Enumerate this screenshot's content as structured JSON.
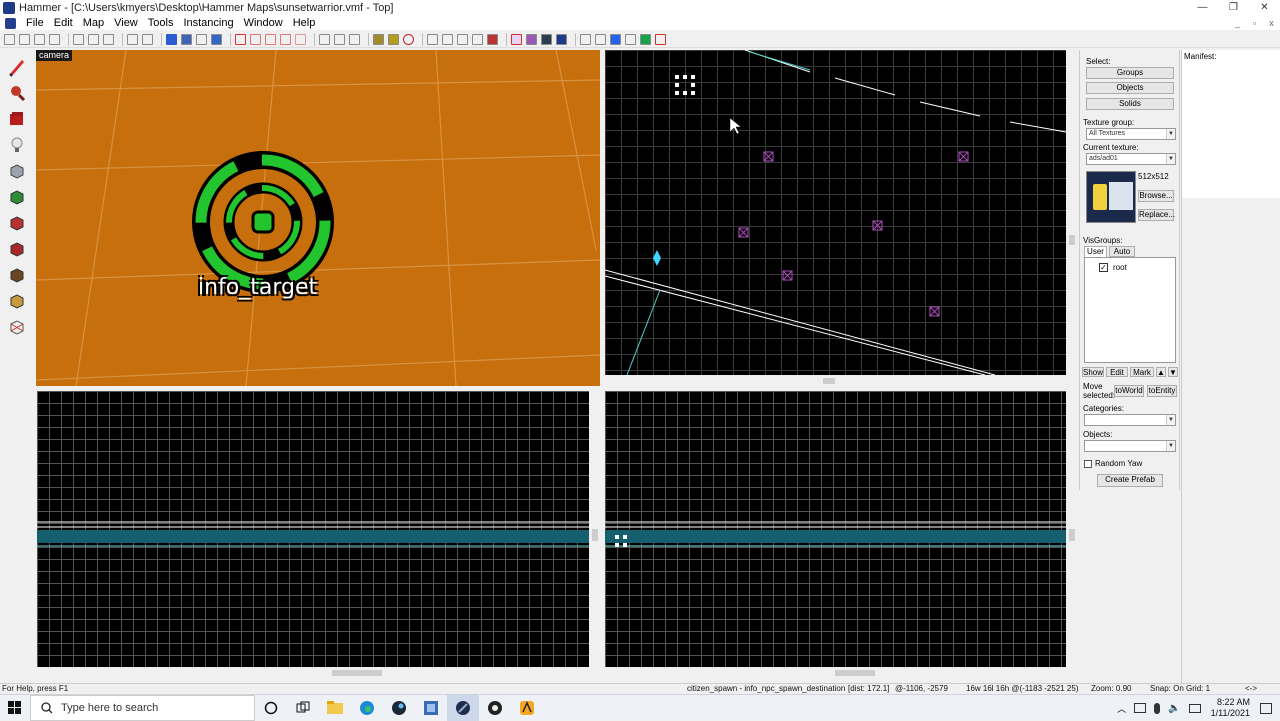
{
  "window": {
    "title": "Hammer - [C:\\Users\\kmyers\\Desktop\\Hammer Maps\\sunsetwarrior.vmf - Top]",
    "controls": {
      "minimize": "—",
      "restore": "❐",
      "close": "✕"
    }
  },
  "menubar": {
    "items": [
      "File",
      "Edit",
      "Map",
      "View",
      "Tools",
      "Instancing",
      "Window",
      "Help"
    ],
    "mdi_controls": {
      "minimize": "_",
      "restore": "▫",
      "close": "x"
    }
  },
  "viewports": {
    "camera": {
      "label": "camera",
      "entity_label": "info_target",
      "bg": "#c66f0c"
    },
    "top": {
      "bg": "#000000"
    },
    "bottom_left": {
      "bg": "#000000"
    },
    "bottom_right": {
      "bg": "#000000"
    }
  },
  "right_panel": {
    "select_label": "Select:",
    "groups_button": "Groups",
    "objects_button": "Objects",
    "solids_button": "Solids",
    "texture_group_label": "Texture group:",
    "texture_group_value": "All Textures",
    "current_texture_label": "Current texture:",
    "current_texture_value": "ads/ad01",
    "texture_size": "512x512",
    "browse_button": "Browse...",
    "replace_button": "Replace...",
    "visgroups_label": "VisGroups:",
    "tab_user": "User",
    "tab_auto": "Auto",
    "visgroup_item": "root",
    "show_button": "Show",
    "edit_button": "Edit",
    "mark_button": "Mark",
    "up_arrow": "▲",
    "down_arrow": "▼",
    "move_selected_label_1": "Move",
    "move_selected_label_2": "selected:",
    "toworld_button": "toWorld",
    "toentity_button": "toEntity",
    "categories_label": "Categories:",
    "objects_label": "Objects:",
    "random_yaw_label": "Random Yaw",
    "create_prefab_button": "Create Prefab"
  },
  "manifest": {
    "label": "Manifest:"
  },
  "statusbar": {
    "help": "For Help, press F1",
    "selection": "citizen_spawn - info_npc_spawn_destination",
    "dist": "[dist: 172.1]",
    "coords": "@-1106, -2579",
    "size": "16w 16l 16h @(-1183 -2521 25)",
    "zoom": "Zoom: 0.90",
    "snap": "Snap: On Grid: 1",
    "arrows": "<->"
  },
  "taskbar": {
    "search_placeholder": "Type here to search",
    "time": "8:22 AM",
    "date": "1/11/2021"
  }
}
